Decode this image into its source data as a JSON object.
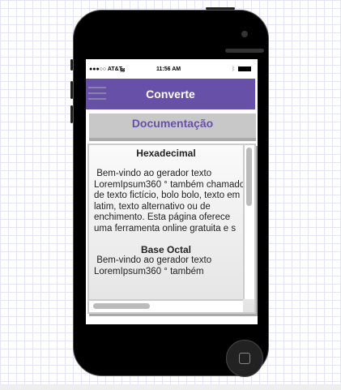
{
  "status": {
    "carrier": "●●●○○ AT&T",
    "time": "11:56 AM"
  },
  "header": {
    "title": "Converte",
    "menu_icon": "hamburger-list-icon"
  },
  "doc_button": "Documentação",
  "sections": [
    {
      "title": "Hexadecimal",
      "lines": [
        " Bem-vindo ao gerador texto",
        "LoremIpsum360 ° também chamado",
        "de texto fictício, bolo bolo, texto em",
        "latim, texto alternativo ou de",
        "enchimento. Esta página oferece",
        "uma ferramenta online gratuita e s"
      ]
    },
    {
      "title": "Base Octal",
      "lines": [
        " Bem-vindo ao gerador texto",
        "LoremIpsum360 ° também"
      ]
    }
  ],
  "colors": {
    "accent": "#6750a8",
    "button": "#c8c8c8"
  }
}
